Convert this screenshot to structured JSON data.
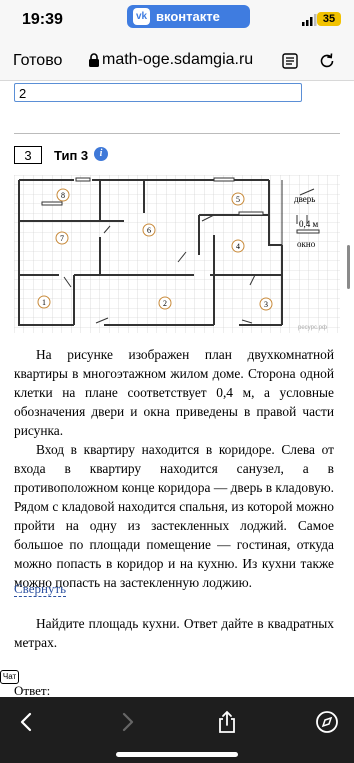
{
  "status_bar": {
    "time": "19:39",
    "app_banner": "вконтакте",
    "vk_logo": "vk",
    "battery": "35"
  },
  "browser": {
    "done_label": "Готово",
    "url": "math-oge.sdamgia.ru"
  },
  "page": {
    "answer_value": "2",
    "task_number": "3",
    "task_type": "Тип 3",
    "info_icon": "i",
    "plan_labels": {
      "rooms": [
        "1",
        "2",
        "3",
        "4",
        "5",
        "6",
        "7",
        "8"
      ],
      "legend_door": "дверь",
      "legend_scale": "0,4 м",
      "legend_window": "окно",
      "watermark": "ресурс.рф"
    },
    "paragraph1": "На рисунке изображен план двухкомнатной квартиры в многоэтажном жилом доме. Сторона одной клетки на плане соответствует 0,4 м, а условные обозначения двери и окна приведены в правой части рисунка.",
    "paragraph2": "Вход в квартиру находится в коридоре. Слева от входа в квартиру находится санузел, а в противоположном конце коридора — дверь в кладовую. Рядом с кладовой находится спальня, из которой можно пройти на одну из застекленных лоджий. Самое большое по площади помещение — гостиная, откуда можно попасть в коридор и на кухню. Из кухни также можно попасть на застекленную лоджию.",
    "collapse_label": "Свернуть",
    "question": "Найдите площадь кухни. Ответ дайте в квадратных метрах.",
    "chat_badge": "Чат",
    "answer_label": "Ответ:"
  },
  "colors": {
    "vk_blue": "#3f7ce0",
    "battery_yellow": "#f2c200",
    "link": "#2a4f9f",
    "toolbar_bg": "#1e1e1e"
  },
  "icons": [
    "lock-icon",
    "reader-mode-icon",
    "reload-icon",
    "back-icon",
    "forward-icon",
    "share-icon",
    "compass-icon",
    "info-icon"
  ]
}
